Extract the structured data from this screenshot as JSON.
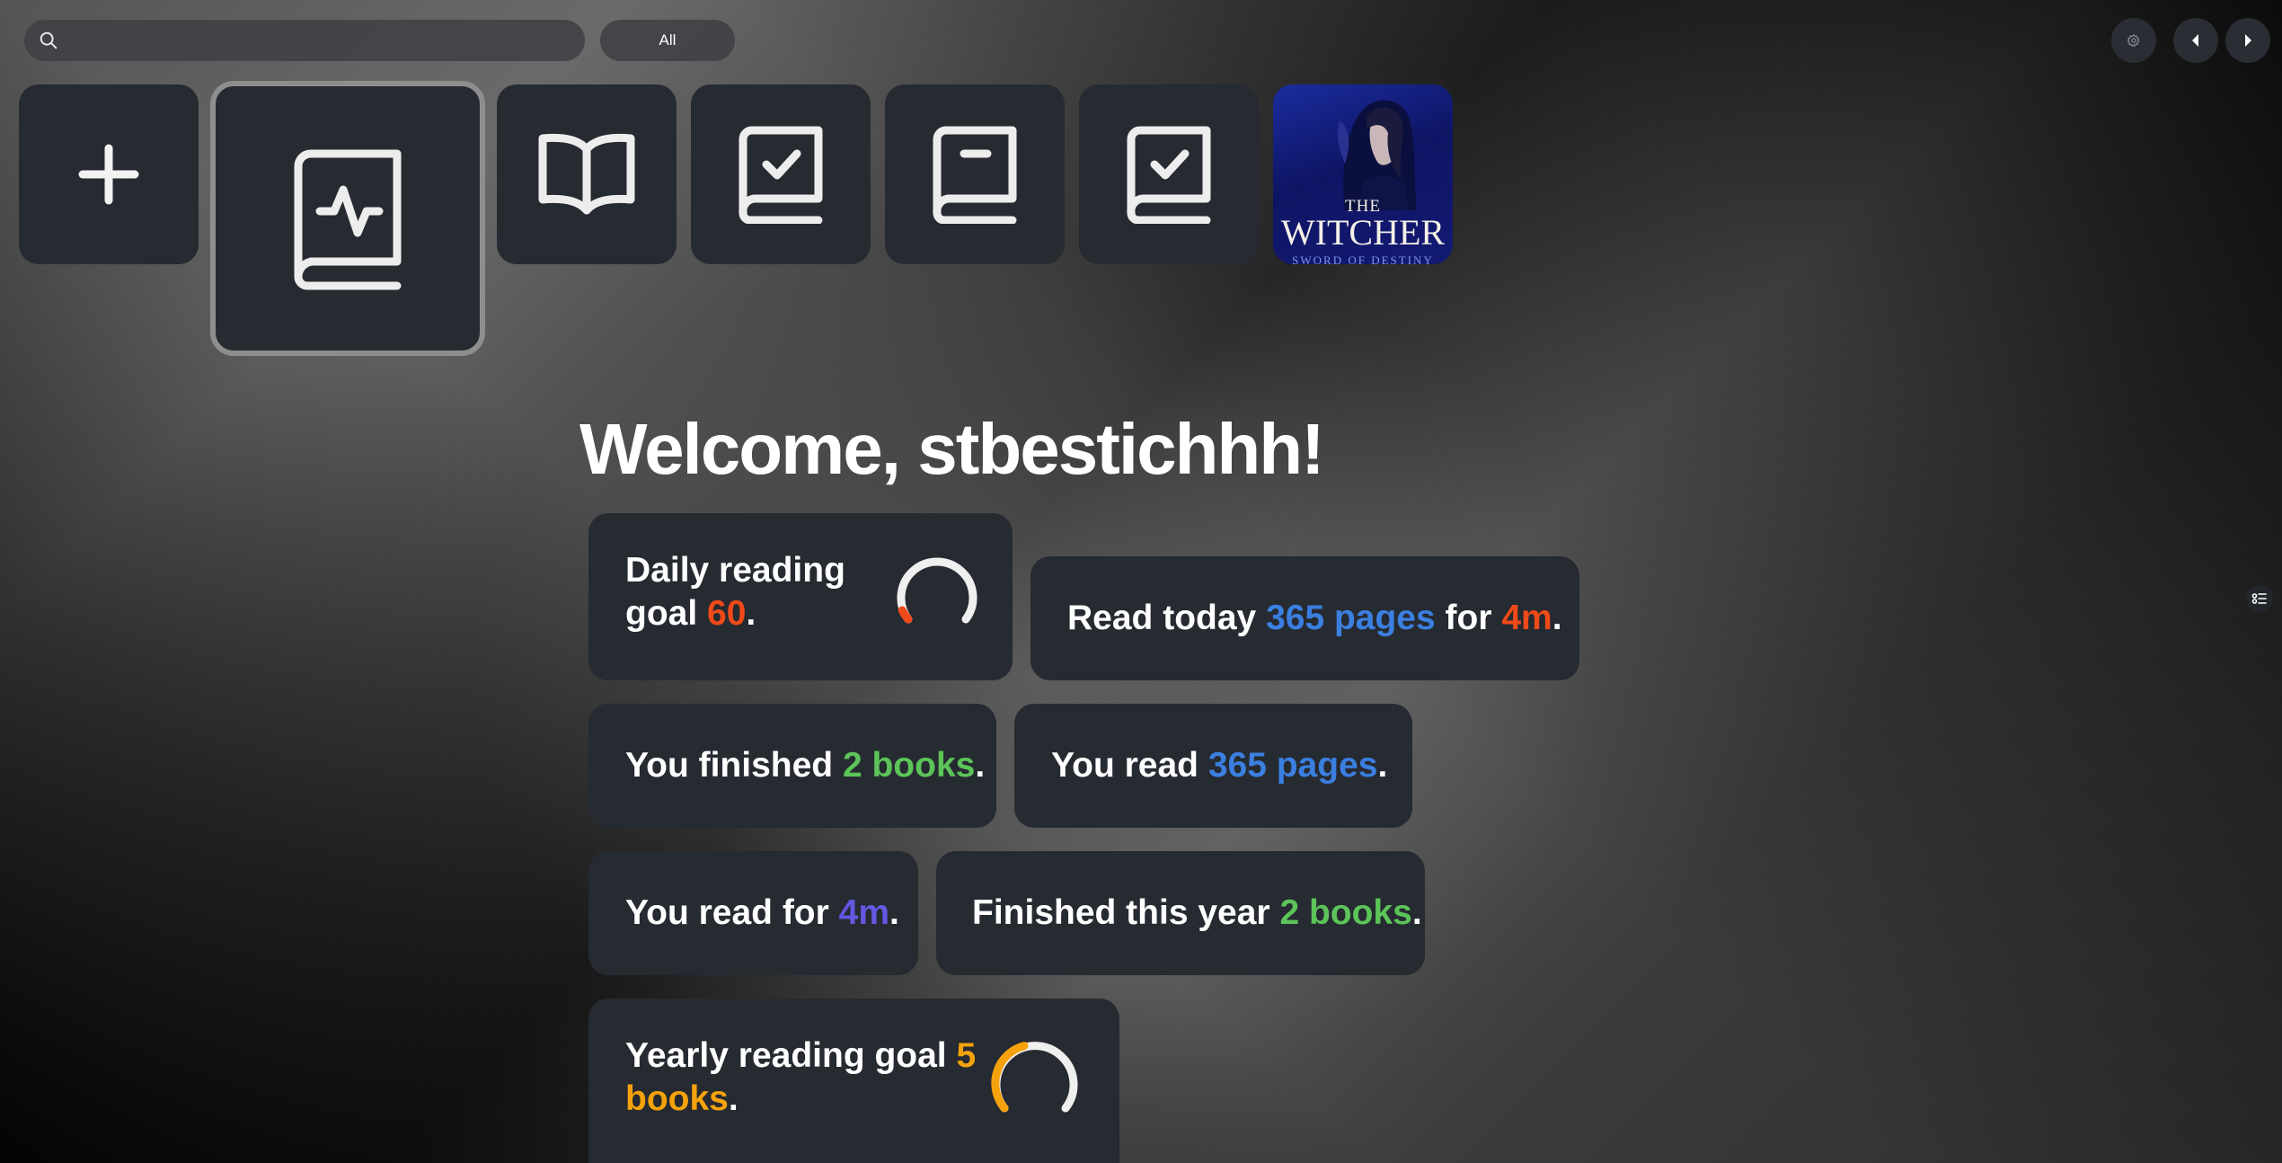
{
  "search": {
    "placeholder": "",
    "value": ""
  },
  "filter": {
    "label": "All"
  },
  "toolbar": {
    "settings_icon": "gear-icon",
    "prev_icon": "caret-left-icon",
    "next_icon": "caret-right-icon"
  },
  "tiles": [
    {
      "icon": "plus-icon"
    },
    {
      "icon": "book-activity-icon",
      "selected": true
    },
    {
      "icon": "open-book-icon"
    },
    {
      "icon": "book-check-icon"
    },
    {
      "icon": "book-bookmark-icon"
    },
    {
      "icon": "book-check-icon"
    },
    {
      "icon": "book-cover",
      "cover_top": "THE",
      "cover_title": "WITCHER",
      "cover_sub": "SWORD OF DESTINY"
    }
  ],
  "welcome": {
    "text": "Welcome, stbestichhh!"
  },
  "stats": {
    "daily_goal": {
      "prefix": "Daily reading goal ",
      "value": "60",
      "suffix": ".",
      "progress": 0.05,
      "color": "#ef4a19"
    },
    "read_today": {
      "prefix": "Read today ",
      "pages": "365 pages",
      "mid": " for ",
      "time": "4m",
      "suffix": "."
    },
    "finished": {
      "prefix": "You finished ",
      "value": "2 books",
      "suffix": "."
    },
    "pages_read": {
      "prefix": "You read ",
      "value": "365 pages",
      "suffix": "."
    },
    "time_read": {
      "prefix": "You read for ",
      "value": "4m",
      "suffix": "."
    },
    "finished_year": {
      "prefix": "Finished this year ",
      "value": "2 books",
      "suffix": "."
    },
    "yearly_goal": {
      "prefix": "Yearly reading goal ",
      "value_1": "5",
      "value_2": "books",
      "suffix": ".",
      "progress": 0.4,
      "color": "#f5a20c"
    }
  }
}
